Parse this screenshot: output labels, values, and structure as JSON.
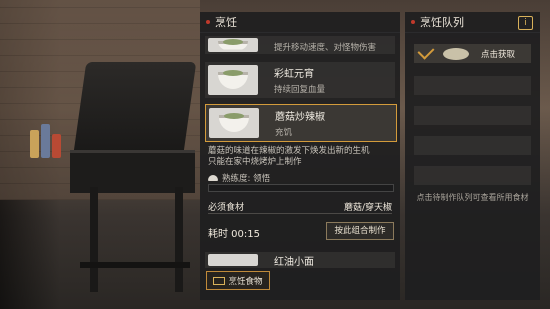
{
  "left_panel": {
    "title": "烹饪",
    "recipes": [
      {
        "name": "",
        "desc": "提升移动速度、对怪物伤害"
      },
      {
        "name": "彩虹元宵",
        "desc": "持续回复血量"
      },
      {
        "name": "蘑菇炒辣椒",
        "desc": "充饥"
      }
    ],
    "detail_text": "蘑菇的味道在辣椒的激发下焕发出新的生机\n只能在家中烧烤炉上制作",
    "proficiency": "熟练度: 领悟",
    "ingredients_label": "必须食材",
    "ingredients_value": "蘑菇/穿天椒",
    "time_text": "耗时 00:15",
    "combo_button": "按此组合制作",
    "next_recipe": "红油小面",
    "cook_button": "烹饪食物"
  },
  "right_panel": {
    "title": "烹饪队列",
    "info_icon": "i",
    "queue_slot_label": "点击获取",
    "hint": "点击待制作队列可查看所用食材"
  },
  "colors": {
    "accent": "#d39b3b",
    "title_dot": "#c0392b"
  }
}
